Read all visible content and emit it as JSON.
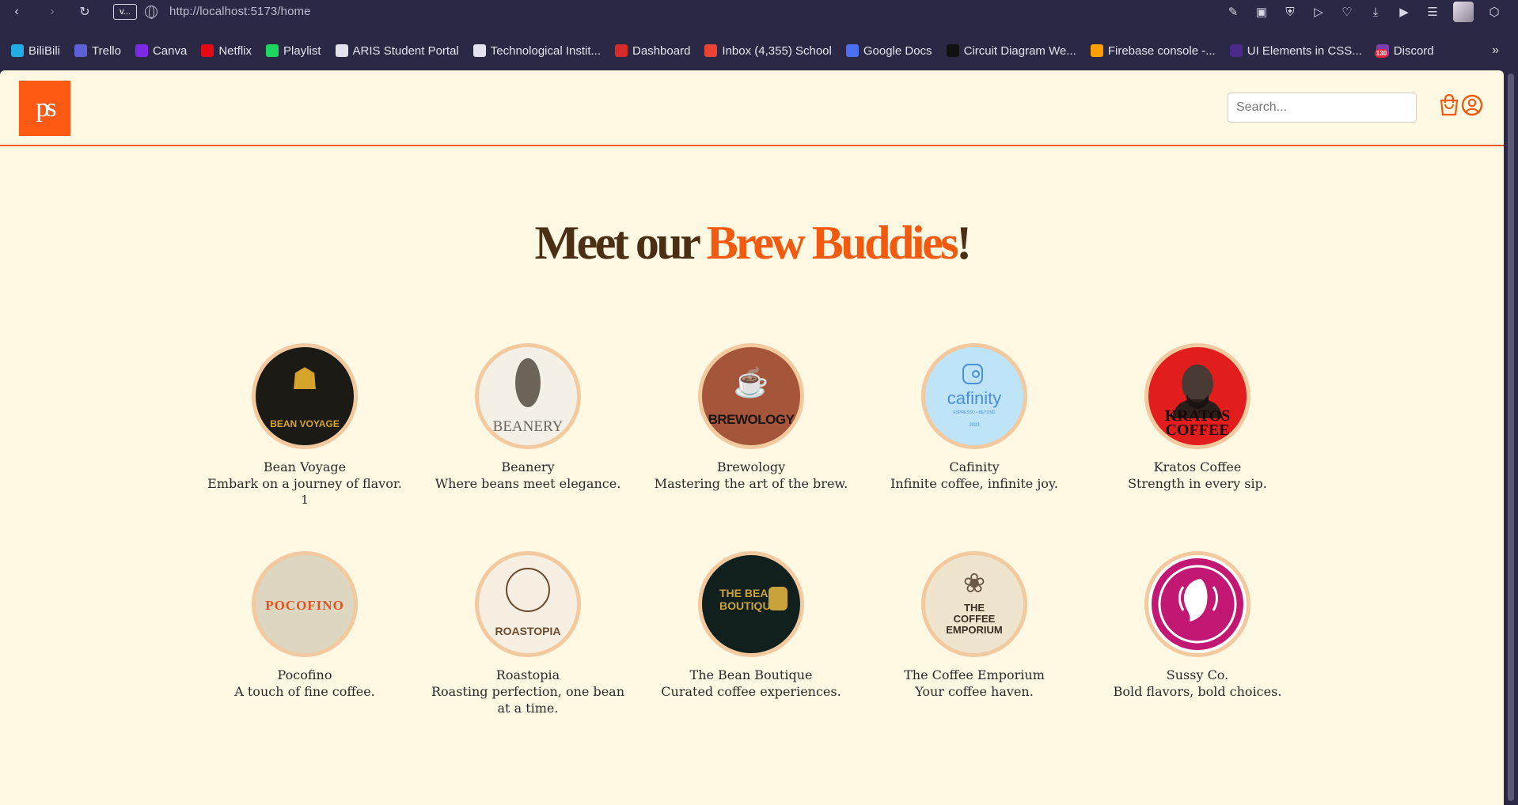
{
  "browser": {
    "url": "http://localhost:5173/home",
    "tab_chip": "v..."
  },
  "bookmarks": [
    {
      "label": "BiliBili",
      "color": "#23ade5",
      "icon": "bilibili-icon"
    },
    {
      "label": "Trello",
      "color": "#5b61d6",
      "icon": "trello-icon"
    },
    {
      "label": "Canva",
      "color": "#7d2ae8",
      "icon": "canva-icon"
    },
    {
      "label": "Netflix",
      "color": "#e50914",
      "icon": "netflix-icon"
    },
    {
      "label": "Playlist",
      "color": "#1ed760",
      "icon": "spotify-icon"
    },
    {
      "label": "ARIS Student Portal",
      "color": "#e4e2ee",
      "icon": "page-icon"
    },
    {
      "label": "Technological Instit...",
      "color": "#e4e2ee",
      "icon": "page-icon"
    },
    {
      "label": "Dashboard",
      "color": "#d62b2b",
      "icon": "dashboard-icon"
    },
    {
      "label": "Inbox (4,355) School",
      "color": "#ea4335",
      "icon": "gmail-icon"
    },
    {
      "label": "Google Docs",
      "color": "#4e6ef2",
      "icon": "docs-icon"
    },
    {
      "label": "Circuit Diagram We...",
      "color": "#111111",
      "icon": "circuit-icon"
    },
    {
      "label": "Firebase console -...",
      "color": "#ffa000",
      "icon": "firebase-icon"
    },
    {
      "label": "UI Elements in CSS...",
      "color": "#4a2a8a",
      "icon": "ui-elements-icon"
    },
    {
      "label": "Discord",
      "color": "#7b3fb0",
      "icon": "discord-icon",
      "badge": "130"
    }
  ],
  "site": {
    "logo_text": "ps",
    "search_placeholder": "Search...",
    "accent": "#f25a10"
  },
  "heading": {
    "part1": "Meet our",
    "accent": "Brew Buddies",
    "end": "!"
  },
  "shops": [
    {
      "name": "Bean Voyage",
      "tagline": "Embark on a journey of flavor.",
      "badge": "1",
      "logo_text": "BEAN VOYAGE",
      "bg": "#1b1a15",
      "fg": "#d4a52a"
    },
    {
      "name": "Beanery",
      "tagline": "Where beans meet elegance.",
      "logo_text": "BEANERY",
      "bg": "#f4f0e6",
      "fg": "#6b6458"
    },
    {
      "name": "Brewology",
      "tagline": "Mastering the art of the brew.",
      "logo_text": "BREWOLOGY",
      "bg": "#a4553a",
      "fg": "#1c1410"
    },
    {
      "name": "Cafinity",
      "tagline": "Infinite coffee, infinite joy.",
      "logo_text": "cafinity",
      "logo_sub": "ESPRESSO • BEYOND",
      "logo_year": "2023",
      "bg": "#bfe3f7",
      "fg": "#4a8fd8"
    },
    {
      "name": "Kratos Coffee",
      "tagline": "Strength in every sip.",
      "logo_text": "KRATOS COFFEE",
      "bg": "#e21d1d",
      "fg": "#1a0606"
    },
    {
      "name": "Pocofino",
      "tagline": "A touch of fine coffee.",
      "logo_text": "POCOFINO",
      "bg": "#ddd6c0",
      "fg": "#e4521c"
    },
    {
      "name": "Roastopia",
      "tagline": "Roasting perfection, one bean at a time.",
      "logo_text": "ROASTOPIA",
      "bg": "#f6efe2",
      "fg": "#6b4a2e"
    },
    {
      "name": "The Bean Boutique",
      "tagline": "Curated coffee experiences.",
      "logo_text": "THE BEAN BOUTIQUE",
      "bg": "#12201d",
      "fg": "#c9a23a"
    },
    {
      "name": "The Coffee Emporium",
      "tagline": "Your coffee haven.",
      "logo_text": "THE COFFEE EMPORIUM",
      "bg": "#efe5cf",
      "fg": "#3a2e22"
    },
    {
      "name": "Sussy Co.",
      "tagline": "Bold flavors, bold choices.",
      "logo_text": "",
      "bg": "#ffffff",
      "fg": "#c21874"
    }
  ]
}
